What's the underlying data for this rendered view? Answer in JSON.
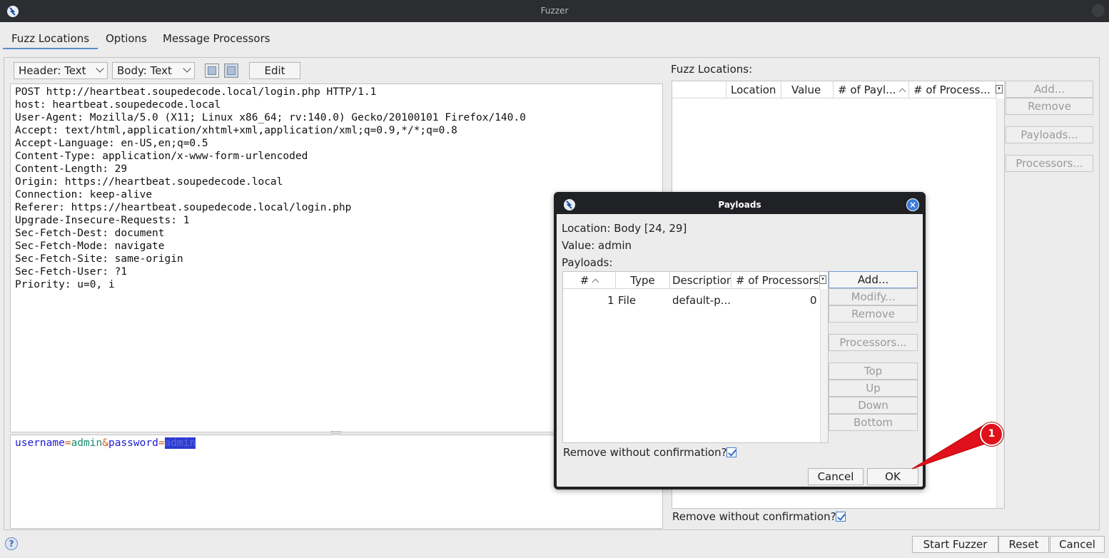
{
  "window": {
    "title": "Fuzzer"
  },
  "tabs": [
    {
      "label": "Fuzz Locations",
      "active": true
    },
    {
      "label": "Options"
    },
    {
      "label": "Message Processors"
    }
  ],
  "toolbar": {
    "header_view": "Header: Text",
    "body_view": "Body: Text",
    "edit_label": "Edit"
  },
  "request": {
    "header_lines": [
      "POST http://heartbeat.soupedecode.local/login.php HTTP/1.1",
      "host: heartbeat.soupedecode.local",
      "User-Agent: Mozilla/5.0 (X11; Linux x86_64; rv:140.0) Gecko/20100101 Firefox/140.0",
      "Accept: text/html,application/xhtml+xml,application/xml;q=0.9,*/*;q=0.8",
      "Accept-Language: en-US,en;q=0.5",
      "Content-Type: application/x-www-form-urlencoded",
      "Content-Length: 29",
      "Origin: https://heartbeat.soupedecode.local",
      "Connection: keep-alive",
      "Referer: https://heartbeat.soupedecode.local/login.php",
      "Upgrade-Insecure-Requests: 1",
      "Sec-Fetch-Dest: document",
      "Sec-Fetch-Mode: navigate",
      "Sec-Fetch-Site: same-origin",
      "Sec-Fetch-User: ?1",
      "Priority: u=0, i"
    ],
    "body": {
      "param1": "username",
      "eq1": "=",
      "value1": "admin",
      "amp": "&",
      "param2": "password",
      "eq2": "=",
      "value2": "admin"
    }
  },
  "fuzz_locations": {
    "label": "Fuzz Locations:",
    "columns": [
      "",
      "Location",
      "Value",
      "# of Payl...",
      "# of Process..."
    ],
    "buttons": {
      "add": "Add...",
      "remove": "Remove",
      "payloads": "Payloads...",
      "processors": "Processors..."
    },
    "remove_without_confirmation": "Remove without confirmation?"
  },
  "payloads_dialog": {
    "title": "Payloads",
    "location": "Location: Body [24, 29]",
    "value": "Value: admin",
    "payloads_label": "Payloads:",
    "columns": [
      "#",
      "Type",
      "Description",
      "# of Processors"
    ],
    "rows": [
      {
        "num": "1",
        "type": "File",
        "description": "default-p...",
        "processors": "0"
      }
    ],
    "buttons": {
      "add": "Add...",
      "modify": "Modify...",
      "remove": "Remove",
      "processors": "Processors...",
      "top": "Top",
      "up": "Up",
      "down": "Down",
      "bottom": "Bottom",
      "cancel": "Cancel",
      "ok": "OK"
    },
    "remove_without_confirmation": "Remove without confirmation?"
  },
  "footer": {
    "start": "Start Fuzzer",
    "reset": "Reset",
    "cancel": "Cancel"
  },
  "annotation": {
    "badge": "1",
    "color": "#e0111b"
  }
}
